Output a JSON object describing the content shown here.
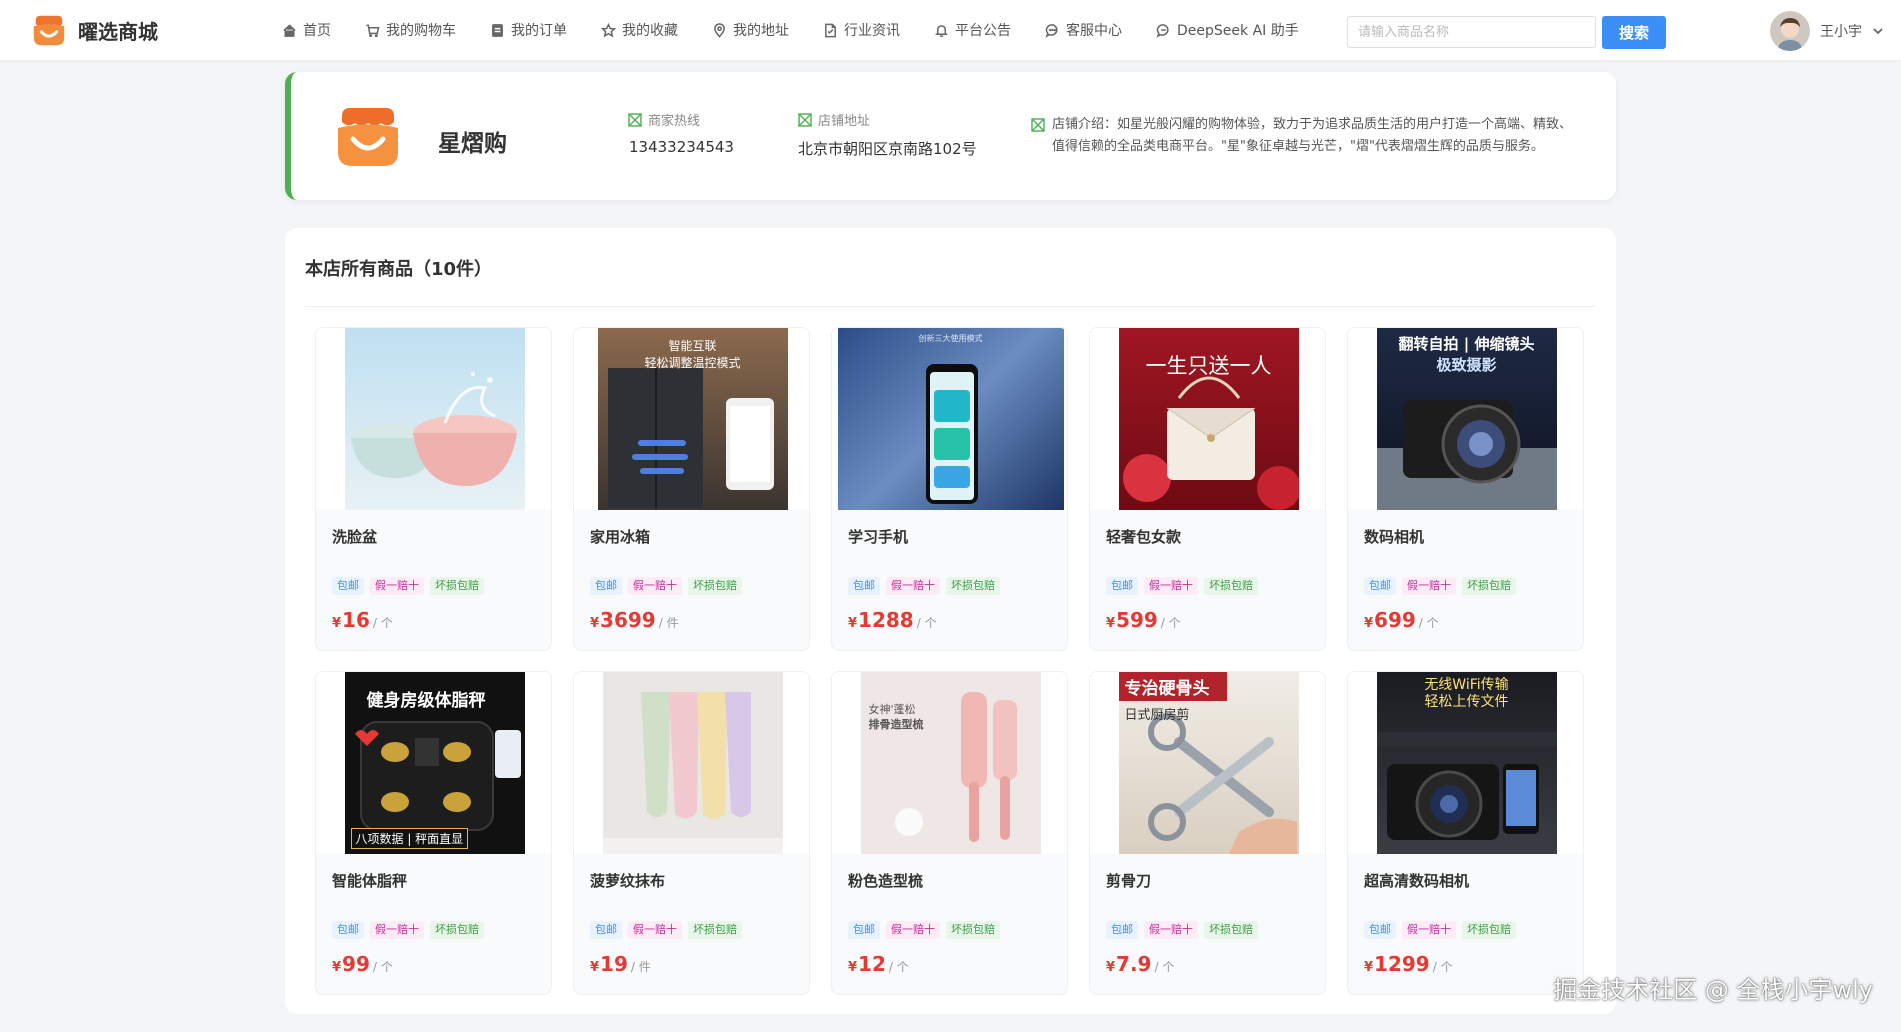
{
  "app": {
    "name": "曜选商城"
  },
  "nav": {
    "items": [
      {
        "label": "首页",
        "icon": "home-icon"
      },
      {
        "label": "我的购物车",
        "icon": "cart-icon"
      },
      {
        "label": "我的订单",
        "icon": "order-icon"
      },
      {
        "label": "我的收藏",
        "icon": "star-icon"
      },
      {
        "label": "我的地址",
        "icon": "location-icon"
      },
      {
        "label": "行业资讯",
        "icon": "news-icon"
      },
      {
        "label": "平台公告",
        "icon": "bell-icon"
      },
      {
        "label": "客服中心",
        "icon": "chat-icon"
      },
      {
        "label": "DeepSeek AI 助手",
        "icon": "ai-chat-icon"
      }
    ]
  },
  "search": {
    "placeholder": "请输入商品名称",
    "button": "搜索"
  },
  "user": {
    "name": "王小宇"
  },
  "store": {
    "name": "星熠购",
    "hotline_label": "商家热线",
    "hotline": "13433234543",
    "address_label": "店铺地址",
    "address": "北京市朝阳区京南路102号",
    "desc": "店铺介绍：如星光般闪耀的购物体验，致力于为追求品质生活的用户打造一个高端、精致、值得信赖的全品类电商平台。\"星\"象征卓越与光芒，\"熠\"代表熠熠生辉的品质与服务。"
  },
  "products_panel": {
    "title": "本店所有商品（10件）",
    "tags": [
      "包邮",
      "假一赔十",
      "坏损包赔"
    ],
    "currency": "¥",
    "items": [
      {
        "name": "洗脸盆",
        "price": "16",
        "unit": "/ 个"
      },
      {
        "name": "家用冰箱",
        "price": "3699",
        "unit": "/ 件",
        "img_text": [
          "智能互联",
          "轻松调整温控模式"
        ]
      },
      {
        "name": "学习手机",
        "price": "1288",
        "unit": "/ 个",
        "img_text": [
          "创新三大使用模式"
        ]
      },
      {
        "name": "轻奢包女款",
        "price": "599",
        "unit": "/ 个",
        "img_text": [
          "一生只送一人"
        ]
      },
      {
        "name": "数码相机",
        "price": "699",
        "unit": "/ 个",
        "img_text": [
          "翻转自拍 | 伸缩镜头",
          "极致摄影"
        ]
      },
      {
        "name": "智能体脂秤",
        "price": "99",
        "unit": "/ 个",
        "img_text": [
          "健身房级体脂秤",
          "八项数据 | 秤面直显"
        ]
      },
      {
        "name": "菠萝纹抹布",
        "price": "19",
        "unit": "/ 件"
      },
      {
        "name": "粉色造型梳",
        "price": "12",
        "unit": "/ 个",
        "img_text": [
          "女神'蓬松",
          "排骨造型梳"
        ]
      },
      {
        "name": "剪骨刀",
        "price": "7.9",
        "unit": "/ 个",
        "img_text": [
          "专治硬骨头",
          "日式厨房剪"
        ]
      },
      {
        "name": "超高清数码相机",
        "price": "1299",
        "unit": "/ 个",
        "img_text": [
          "无线WiFi传输",
          "轻松上传文件"
        ]
      }
    ]
  },
  "watermark": "掘金技术社区 @ 全栈小宇wly",
  "colors": {
    "accent": "#3b8ff7",
    "price": "#e53935",
    "store_border": "#4caf50",
    "logo": "#f0742e"
  }
}
